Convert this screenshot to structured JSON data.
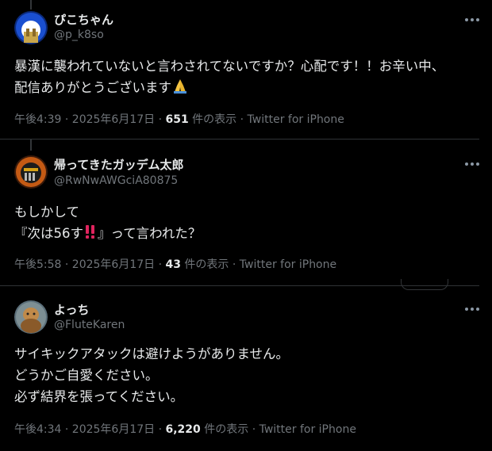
{
  "tweets": [
    {
      "display_name": "ぴこちゃん",
      "handle": "@p_k8so",
      "text_lines": [
        "暴漢に襲われていないと言わされてないですか？心配です！！お辛い中、",
        "配信ありがとうございます"
      ],
      "emoji_line2": "pray-emoji",
      "time": "午後4:39 · 2025年6月17日 · ",
      "views_count": "651",
      "views_suffix": " 件の表示 · Twitter for iPhone"
    },
    {
      "display_name": "帰ってきたガッデム太郎",
      "handle": "@RwNwAWGciA80875",
      "text_lines": [
        "もしかして",
        "『次は56す",
        "』って言われた？"
      ],
      "emoji_line2": "double-exclamation-emoji",
      "time": "午後5:58 · 2025年6月17日 · ",
      "views_count": "43",
      "views_suffix": " 件の表示 · Twitter for iPhone"
    },
    {
      "display_name": "よっち",
      "handle": "@FluteKaren",
      "text_lines": [
        "サイキックアタックは避けようがありません。",
        "どうかご自愛ください。",
        "必ず結界を張ってください。"
      ],
      "time": "午後4:34 · 2025年6月17日 · ",
      "views_count": "6,220",
      "views_suffix": " 件の表示 · Twitter for iPhone"
    }
  ],
  "colors": {
    "background": "#000000",
    "text": "#e7e9ea",
    "secondary": "#71767b",
    "divider": "#2f3336"
  }
}
